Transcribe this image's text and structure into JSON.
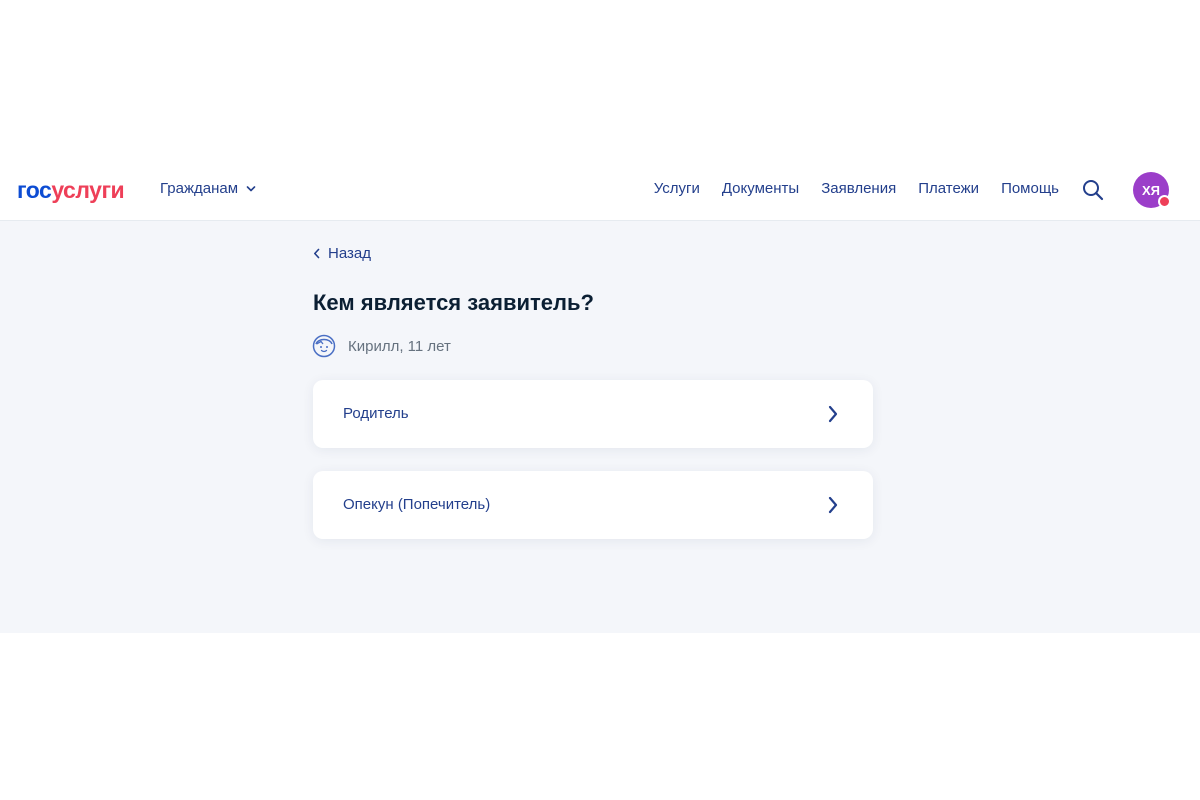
{
  "header": {
    "logo_part1": "гос",
    "logo_part2": "услуги",
    "audience_label": "Гражданам",
    "nav": [
      "Услуги",
      "Документы",
      "Заявления",
      "Платежи",
      "Помощь"
    ],
    "avatar_initials": "ХЯ",
    "colors": {
      "brand_blue": "#0d4cd3",
      "brand_red": "#ee3f58",
      "link": "#233f8c",
      "avatar_bg": "#9b3ec9"
    }
  },
  "main": {
    "back_label": "Назад",
    "title": "Кем является заявитель?",
    "child_label": "Кирилл, 11 лет",
    "options": [
      {
        "label": "Родитель"
      },
      {
        "label": "Опекун (Попечитель)"
      }
    ]
  },
  "icons": {
    "audience_dropdown": "chevron-down-icon",
    "search": "search-icon",
    "back": "chevron-left-icon",
    "child": "child-face-icon",
    "option": "chevron-right-icon"
  }
}
